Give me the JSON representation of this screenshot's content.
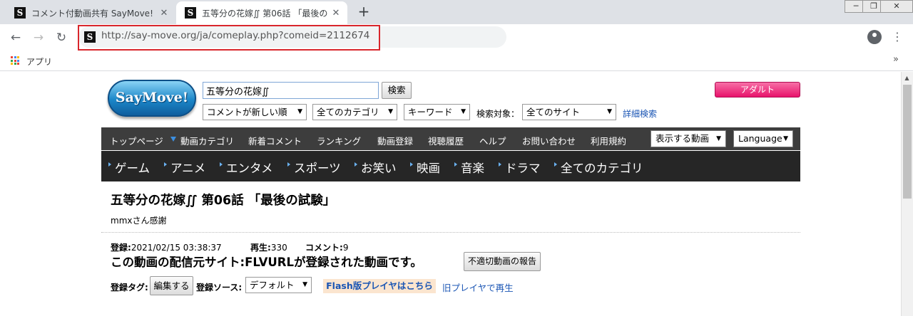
{
  "browser": {
    "tabs": [
      {
        "favicon": "S",
        "title": "コメント付動画共有 SayMove!"
      },
      {
        "favicon": "S",
        "title": "五等分の花嫁∬ 第06話 「最後の"
      }
    ],
    "new_tab": "+",
    "window_controls": {
      "minimize": "─",
      "restore": "❐",
      "close": "✕"
    },
    "nav": {
      "back": "←",
      "forward": "→",
      "reload": "↻"
    },
    "url_favicon": "S",
    "url": "http://say-move.org/ja/comeplay.php?comeid=2112674",
    "menu": "⋮",
    "bookmarks": {
      "apps_label": "アプリ",
      "overflow": "»"
    },
    "apps_colors": [
      "#ea4335",
      "#4285f4",
      "#fbbc05",
      "#34a853",
      "#ea4335",
      "#4285f4",
      "#fbbc05",
      "#34a853",
      "#ea4335"
    ]
  },
  "header": {
    "logo": "SayMove!",
    "search_value": "五等分の花嫁∬",
    "search_button": "検索",
    "adult_button": "アダルト",
    "sort_select": "コメントが新しい順",
    "category_select": "全てのカテゴリ",
    "keyword_select": "キーワード",
    "target_label": "検索対象：",
    "site_select": "全てのサイト",
    "advanced_search": "詳細検索"
  },
  "nav1": {
    "items": [
      "トップページ",
      "動画カテゴリ",
      "新着コメント",
      "ランキング",
      "動画登録",
      "視聴履歴",
      "ヘルプ",
      "お問い合わせ",
      "利用規約"
    ],
    "display_select": "表示する動画",
    "language_select": "Language"
  },
  "nav2": {
    "items": [
      "ゲーム",
      "アニメ",
      "エンタメ",
      "スポーツ",
      "お笑い",
      "映画",
      "音楽",
      "ドラマ",
      "全てのカテゴリ"
    ]
  },
  "video": {
    "title": "五等分の花嫁∬ 第06話 「最後の試験」",
    "uploader": "mmxさん感謝",
    "registered_label": "登録:",
    "registered_value": "2021/02/15 03:38:37",
    "plays_label": "再生:",
    "plays_value": "330",
    "comments_label": "コメント:",
    "comments_value": "9",
    "source_line": "この動画の配信元サイト:FLVURLが登録された動画です。",
    "report_button": "不適切動画の報告",
    "tag_label": "登録タグ:",
    "edit_button": "編集する",
    "source_label": "登録ソース:",
    "source_select": "デフォルト",
    "flash_button": "Flash版プレイヤはこちら",
    "old_player_link": "旧プレイヤで再生"
  }
}
